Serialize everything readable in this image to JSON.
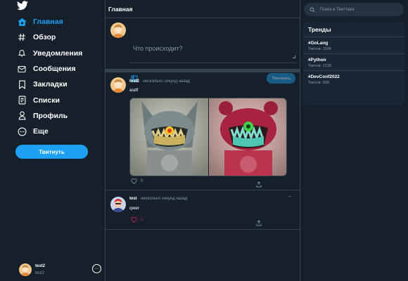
{
  "sidebar": {
    "items": [
      {
        "label": "Главная",
        "icon": "home-icon",
        "active": true
      },
      {
        "label": "Обзор",
        "icon": "hashtag-icon"
      },
      {
        "label": "Уведомления",
        "icon": "bell-icon"
      },
      {
        "label": "Сообщения",
        "icon": "envelope-icon"
      },
      {
        "label": "Закладки",
        "icon": "bookmark-icon"
      },
      {
        "label": "Списки",
        "icon": "list-icon"
      },
      {
        "label": "Профиль",
        "icon": "user-icon"
      },
      {
        "label": "Еще",
        "icon": "more-circle-icon"
      }
    ],
    "tweet_button": "Твитнуть",
    "profile": {
      "name": "test2",
      "handle": "test2"
    }
  },
  "main": {
    "title": "Главная",
    "composer": {
      "placeholder": "Что происходит?",
      "submit_label": "Твитнуть"
    },
    "tweets": [
      {
        "user": "test2",
        "time": "· несколько секунд назад",
        "text": "asdf",
        "likes": "0"
      },
      {
        "user": "test",
        "time": "· несколько секунд назад",
        "text": "qwer",
        "likes": "1"
      }
    ]
  },
  "right": {
    "search_placeholder": "Поиск в Твиттере",
    "trends_title": "Тренды",
    "trends": [
      {
        "tag": "#GoLang",
        "count": "Твитов: 150K"
      },
      {
        "tag": "#Python",
        "count": "Твитов: 121K"
      },
      {
        "tag": "#DevConf2022",
        "count": "Твитов: 90K"
      }
    ]
  },
  "colors": {
    "background": "#15202b",
    "accent": "#1da1f2",
    "border": "#38444d",
    "muted": "#8899a6",
    "like": "#e0245e"
  }
}
